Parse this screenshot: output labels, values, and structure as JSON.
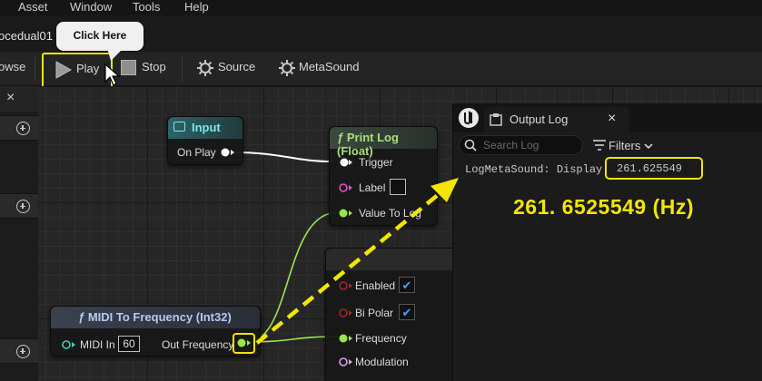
{
  "menu": [
    "Asset",
    "Window",
    "Tools",
    "Help"
  ],
  "document_tab": "ocedual01",
  "toolbar": {
    "browse": "owse",
    "play": "Play",
    "stop": "Stop",
    "source": "Source",
    "metasound": "MetaSound"
  },
  "tooltip": "Click Here",
  "left_panel": {
    "close_glyph": "×"
  },
  "nodes": {
    "input": {
      "title": "Input",
      "pin": "On Play"
    },
    "print_log": {
      "title": "Print Log (Float)",
      "pins": [
        "Trigger",
        "Label",
        "Value To Log"
      ]
    },
    "midi": {
      "title": "MIDI To Frequency (Int32)",
      "midi_in_label": "MIDI In",
      "midi_in_value": "60",
      "out": "Out Frequency"
    },
    "oscillator": {
      "pins": [
        "Enabled",
        "Bi Polar",
        "Frequency",
        "Modulation"
      ]
    }
  },
  "output_log": {
    "tab": "Output Log",
    "close": "×",
    "search_placeholder": "Search Log",
    "filters": "Filters",
    "log_prefix": "LogMetaSound: Display:",
    "log_value": "261.625549"
  },
  "annotation": {
    "text": "261. 6525549 (Hz)"
  },
  "colors": {
    "highlight": "#f2e600",
    "exec_pin": "#ffffff",
    "float_pin": "#9be64a",
    "bool_pin": "#8c1f1f",
    "string_pin": "#e052c8",
    "input_header": "#2a5a5e",
    "function_header": "#3a3f4a"
  }
}
